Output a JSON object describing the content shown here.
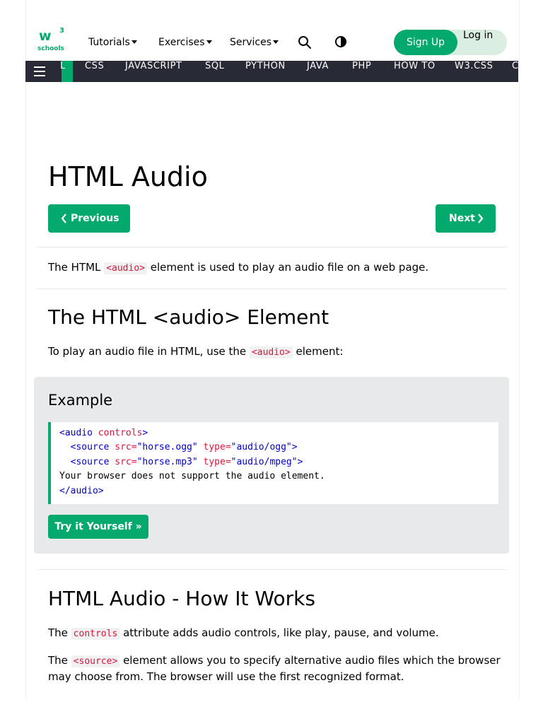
{
  "logo": {
    "main": "w",
    "sup": "3",
    "sub": "schools"
  },
  "topnav": {
    "tutorials": "Tutorials",
    "exercises": "Exercises",
    "services": "Services",
    "signup": "Sign Up",
    "login": "Log in"
  },
  "darknav": {
    "partial_left": "L",
    "items": [
      "CSS",
      "JAVASCRIPT",
      "SQL",
      "PYTHON",
      "JAVA",
      "PHP",
      "HOW TO",
      "W3.CSS",
      "C"
    ]
  },
  "page": {
    "title": "HTML Audio",
    "prev_label": "Previous",
    "next_label": "Next",
    "intro_before": "The HTML ",
    "intro_code": "<audio>",
    "intro_after": " element is used to play an audio file on a web page.",
    "section1_title": "The HTML <audio> Element",
    "section1_before": "To play an audio file in HTML, use the ",
    "section1_code": "<audio>",
    "section1_after": " element:",
    "example_title": "Example",
    "try_label": "Try it Yourself »",
    "section2_title": "HTML Audio - How It Works",
    "p2_before": "The ",
    "p2_code": "controls",
    "p2_after": " attribute adds audio controls, like play, pause, and volume.",
    "p3_before": "The ",
    "p3_code": "<source>",
    "p3_after": " element allows you to specify alternative audio files which the browser may choose from. The browser will use the first recognized format."
  },
  "code_lines": {
    "l1_tag": "<audio ",
    "l1_attr": "controls",
    "l1_end": ">",
    "l2_tag": "<source ",
    "l2_attr1": "src=",
    "l2_val1": "\"horse.ogg\"",
    "l2_attr2": " type=",
    "l2_val2": "\"audio/ogg\"",
    "l2_end": ">",
    "l3_tag": "<source ",
    "l3_attr1": "src=",
    "l3_val1": "\"horse.mp3\"",
    "l3_attr2": " type=",
    "l3_val2": "\"audio/mpeg\"",
    "l3_end": ">",
    "l4_text": "Your browser does not support the audio element.",
    "l5_tag": "</audio>"
  },
  "colors": {
    "brand_green": "#04aa6d",
    "nav_dark": "#282a35",
    "code_red": "#dc143c",
    "code_blue": "#0000cd"
  }
}
